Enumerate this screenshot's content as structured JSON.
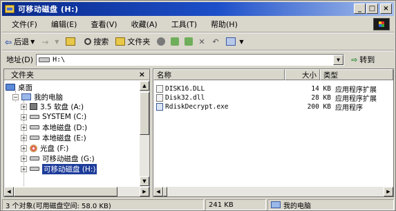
{
  "window": {
    "title": "可移动磁盘 (H:)",
    "minimize": "_",
    "maximize": "□",
    "close": "×"
  },
  "menu": [
    "文件(F)",
    "编辑(E)",
    "查看(V)",
    "收藏(A)",
    "工具(T)",
    "帮助(H)"
  ],
  "toolbar": {
    "back": "后退",
    "search": "搜索",
    "folders": "文件夹"
  },
  "address": {
    "label": "地址(D)",
    "value": "H:\\",
    "go": "转到"
  },
  "tree_pane": {
    "title": "文件夹",
    "close": "×",
    "items": [
      {
        "label": "桌面",
        "icon": "desktop-icon"
      },
      {
        "label": "我的电脑",
        "icon": "computer-icon"
      },
      {
        "label": "3.5 软盘 (A:)",
        "icon": "floppy-icon"
      },
      {
        "label": "SYSTEM (C:)",
        "icon": "drive-icon"
      },
      {
        "label": "本地磁盘 (D:)",
        "icon": "drive-icon"
      },
      {
        "label": "本地磁盘 (E:)",
        "icon": "drive-icon"
      },
      {
        "label": "光盘 (F:)",
        "icon": "cd-icon"
      },
      {
        "label": "可移动磁盘 (G:)",
        "icon": "drive-icon"
      },
      {
        "label": "可移动磁盘 (H:)",
        "icon": "drive-icon",
        "selected": true
      }
    ]
  },
  "file_list": {
    "columns": {
      "name": "名称",
      "size": "大小",
      "type": "类型"
    },
    "rows": [
      {
        "name": "DISK16.DLL",
        "size": "14 KB",
        "type": "应用程序扩展",
        "icon": "dll-file-icon"
      },
      {
        "name": "Disk32.dll",
        "size": "28 KB",
        "type": "应用程序扩展",
        "icon": "dll-file-icon"
      },
      {
        "name": "RdiskDecrypt.exe",
        "size": "200 KB",
        "type": "应用程序",
        "icon": "exe-file-icon"
      }
    ]
  },
  "status": {
    "objects": "3 个对象(可用磁盘空间: 58.0 KB)",
    "size": "241 KB",
    "location": "我的电脑"
  }
}
